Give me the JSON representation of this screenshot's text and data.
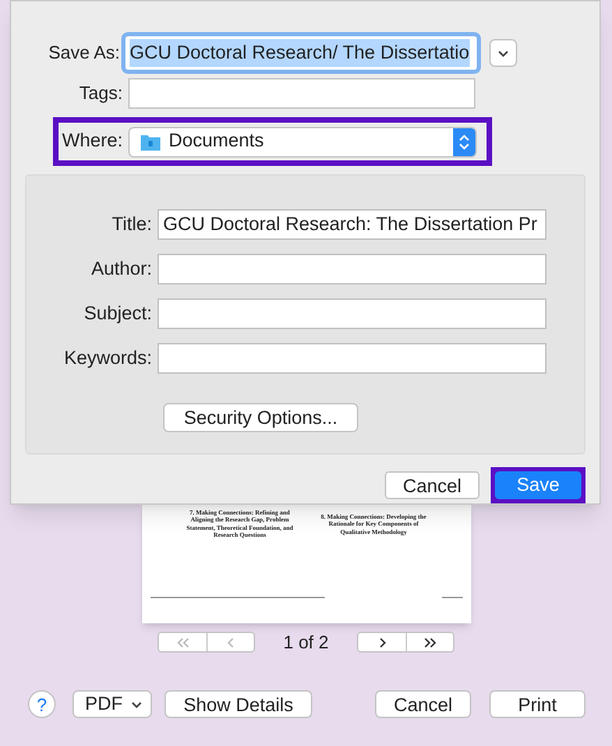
{
  "save_sheet": {
    "save_as": {
      "label": "Save As:",
      "value": "GCU Doctoral Research/ The Dissertatio",
      "focused": true
    },
    "tags": {
      "label": "Tags:"
    },
    "where": {
      "label": "Where:",
      "value": "Documents",
      "highlighted": true
    },
    "fields": [
      {
        "label": "Title:",
        "value": "GCU Doctoral Research: The Dissertation Pr"
      },
      {
        "label": "Author:"
      },
      {
        "label": "Subject:"
      },
      {
        "label": "Keywords:"
      }
    ],
    "security_button": "Security Options...",
    "buttons": [
      {
        "label": "Cancel",
        "default": false,
        "highlighted": false
      },
      {
        "label": "Save",
        "default": true,
        "highlighted": true
      }
    ]
  },
  "preview": {
    "headings": [
      "7. Making Connections: Refining and Aligning the Research Gap, Problem Statement, Theoretical Foundation, and Research Questions",
      "8. Making Connections: Developing the Rationale for Key Components of Qualitative Methodology"
    ],
    "page_indicator": "1 of 2"
  },
  "bottom_bar": {
    "help": "?",
    "pdf": "PDF",
    "show_details": "Show Details",
    "cancel": "Cancel",
    "print": "Print"
  }
}
